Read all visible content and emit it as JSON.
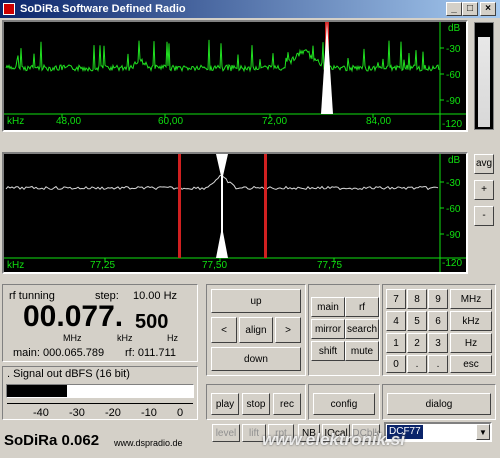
{
  "window": {
    "title": "SoDiRa Software Defined Radio"
  },
  "scope_top": {
    "unit_x": "kHz",
    "unit_y": "dB",
    "x_ticks": [
      "48,00",
      "60,00",
      "72,00",
      "84,00"
    ],
    "y_ticks": [
      "-30",
      "-60",
      "-90",
      "-120"
    ]
  },
  "scope_bottom": {
    "unit_x": "kHz",
    "unit_y": "dB",
    "x_ticks": [
      "77,25",
      "77,50",
      "77,75"
    ],
    "y_ticks": [
      "-30",
      "-60",
      "-90",
      "-120"
    ]
  },
  "side_buttons": {
    "avg": "avg",
    "plus": "+",
    "minus": "-"
  },
  "freq_panel": {
    "rf_tuning_label": "rf tunning",
    "step_label": "step:",
    "step_value": "10.00 Hz",
    "freq_main": "00.077.",
    "freq_fine": "500",
    "unit_mhz": "MHz",
    "unit_khz": "kHz",
    "unit_hz": "Hz",
    "main_label": "main: 000.065.789",
    "rf_label": "rf: 011.711"
  },
  "signal": {
    "label": ". Signal out dBFS (16 bit)",
    "scale": [
      "-40",
      "-30",
      "-20",
      "-10",
      "0"
    ],
    "level_fraction": 0.32
  },
  "tune_buttons": {
    "up": "up",
    "left": "<",
    "align": "align",
    "right": ">",
    "down": "down"
  },
  "mode_buttons": {
    "main": "main",
    "rf": "rf",
    "mirror": "mirror",
    "search": "search",
    "shift": "shift",
    "mute": "mute"
  },
  "keypad": {
    "row1": [
      "7",
      "8",
      "9",
      "MHz"
    ],
    "row2": [
      "4",
      "5",
      "6",
      "kHz"
    ],
    "row3": [
      "1",
      "2",
      "3",
      "Hz"
    ],
    "row4": [
      "0",
      ".",
      ".",
      "esc"
    ]
  },
  "transport": {
    "play": "play",
    "stop": "stop",
    "rec": "rec",
    "config": "config",
    "dialog": "dialog"
  },
  "bottom_buttons": {
    "level": "level",
    "lift": "lift",
    "rpt": "rpt",
    "nb": "NB",
    "iq": "IQcal",
    "dcbl": "DCblk"
  },
  "preset_select": {
    "value": "DCF77"
  },
  "footer": {
    "app_name": "SoDiRa 0.062",
    "url": "www.dspradio.de",
    "watermark": "www.elektronik.si"
  },
  "colors": {
    "trace": "#20e020",
    "marker": "#d02020",
    "axis": "#10e010"
  }
}
